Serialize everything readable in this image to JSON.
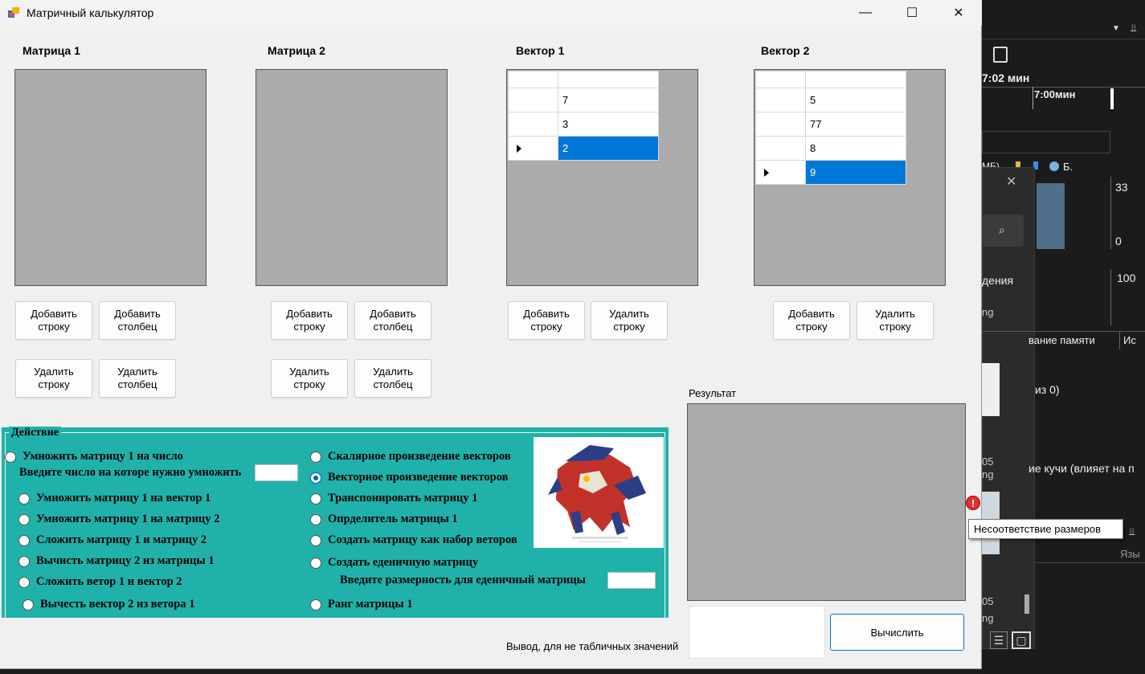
{
  "window": {
    "title": "Матричный калькулятор",
    "minimize": "—",
    "maximize": "☐",
    "close": "✕"
  },
  "matrix1": {
    "label": "Матрица 1",
    "add_row": "Добавить\nстроку",
    "add_col": "Добавить\nстолбец",
    "del_row": "Удалить\nстроку",
    "del_col": "Удалить\nстолбец"
  },
  "matrix2": {
    "label": "Матрица 2",
    "add_row": "Добавить\nстроку",
    "add_col": "Добавить\nстолбец",
    "del_row": "Удалить\nстроку",
    "del_col": "Удалить\nстолбец"
  },
  "vector1": {
    "label": "Вектор 1",
    "values": [
      "7",
      "3",
      "2"
    ],
    "add_row": "Добавить\nстроку",
    "del_row": "Удалить\nстроку"
  },
  "vector2": {
    "label": "Вектор 2",
    "values": [
      "5",
      "77",
      "8",
      "9"
    ],
    "add_row": "Добавить\nстроку",
    "del_row": "Удалить\nстроку"
  },
  "action": {
    "legend": "Действие",
    "mult_by_number": "Умножить матрицу 1 на число",
    "enter_number": "Введите число на которе нужно умножить",
    "mult_by_vector": "Умножить матрицу 1 на вектор 1",
    "mult_by_matrix": "Умножить матрицу 1 на матрицу 2",
    "add_matrices": "Сложить матрицу 1 и матрицу 2",
    "sub_matrices": "Вычисть матрицу 2 из матрицы 1",
    "add_vectors": "Сложить ветор 1 и вектор 2",
    "sub_vectors": "Вычесть вектор 2 из ветора 1",
    "scalar_product": "Скалярное произведение векторов",
    "vector_product": "Векторное произведение векторов",
    "transpose": "Транспонировать матрицу 1",
    "determinant": "Опрделитель матрицы 1",
    "matrix_from_vectors": "Создать матрицу как набор веторов",
    "identity": "Создать еденичную матрицу",
    "enter_dim": "Введите размерность для еденичный матрицы",
    "rank": "Ранг матрицы 1"
  },
  "result": {
    "label": "Результат",
    "output_label": "Вывод, для не табличных значений",
    "calc_button": "Вычислить"
  },
  "tooltip": "Несоответствие размеров",
  "background_app": {
    "time1": "7:02 мин",
    "time2": "7:00мин",
    "legend_text": "МБ)",
    "legend_b": "Б.",
    "num33": "33",
    "num0": "0",
    "num100": "100",
    "denia": "дения",
    "ng1": "ng",
    "memory_tab": "вание памяти",
    "tab_is": "Ис",
    "of0": "из 0)",
    "n05a": "05",
    "ng2": "ng",
    "heap": "ие кучи (влияет на п",
    "lang": "Язы",
    "n05b": "05",
    "ng3": "ng"
  },
  "colors": {
    "accent": "#0078d7",
    "action_bg": "#20b2aa",
    "grid_bg": "#ababab"
  }
}
